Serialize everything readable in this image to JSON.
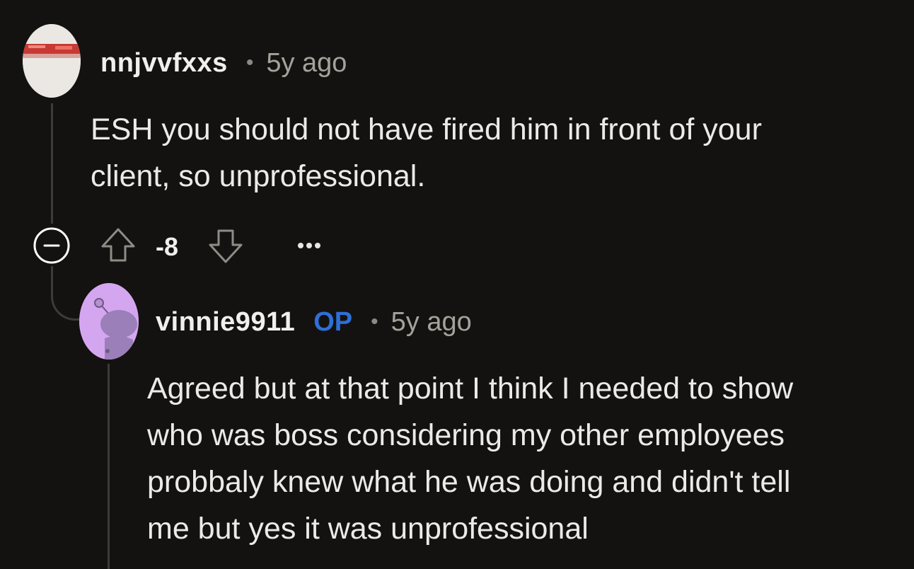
{
  "comments": [
    {
      "username": "nnjvvfxxs",
      "separator": "•",
      "timestamp": "5y ago",
      "body_lines": [
        "ESH you should not have fired him in front of your",
        "client, so unprofessional."
      ],
      "actions": {
        "score": "-8",
        "collapse_icon": "minus-circle-icon",
        "upvote_icon": "arrow-up-icon",
        "downvote_icon": "arrow-down-icon",
        "more_icon": "ellipsis-icon"
      }
    },
    {
      "username": "vinnie9911",
      "badge": "OP",
      "separator": "•",
      "timestamp": "5y ago",
      "body_lines": [
        "Agreed but at that point I think I needed to show",
        "who was boss considering my other employees",
        "probbaly knew what he was doing and didn't tell",
        "me but yes it was unprofessional"
      ]
    }
  ],
  "colors": {
    "background": "#141210",
    "op_badge": "#2f6fd8",
    "avatar2_bg": "#d4a6f0",
    "thread_line": "#3d3b39"
  }
}
